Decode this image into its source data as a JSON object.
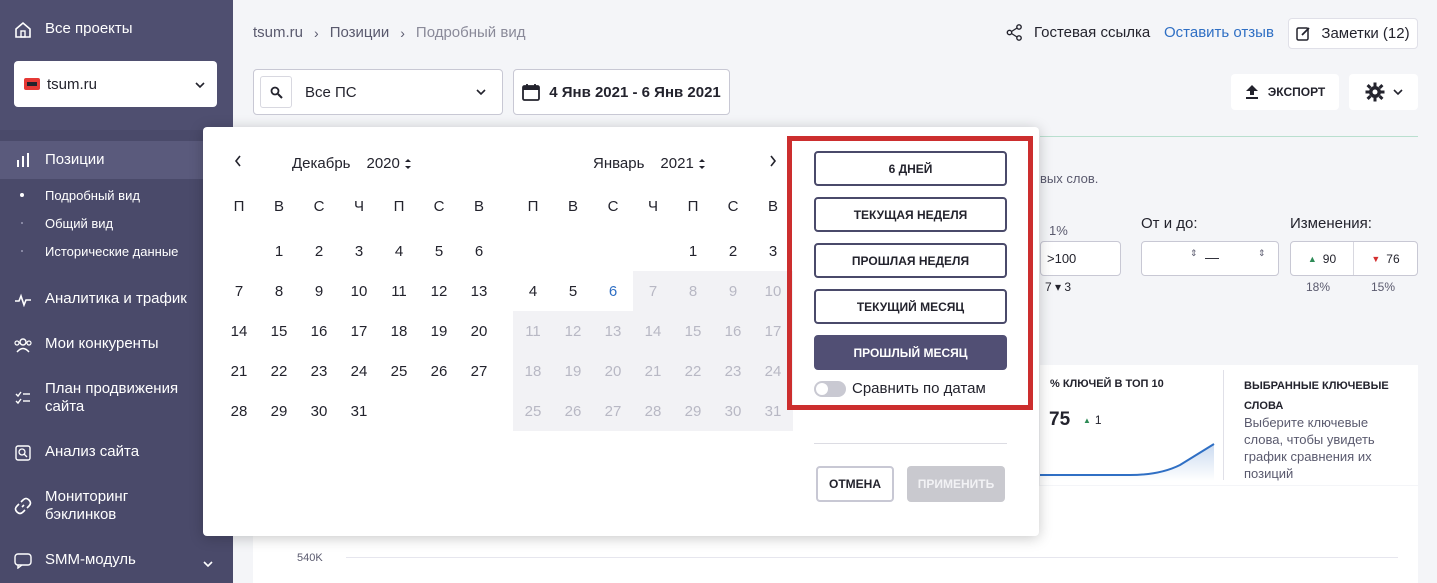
{
  "sidebar": {
    "all_projects": "Все проекты",
    "project": "tsum.ru",
    "items": [
      {
        "label": "Позиции"
      },
      {
        "label": "Аналитика и трафик"
      },
      {
        "label": "Мои конкуренты"
      },
      {
        "label": "План продвижения сайта"
      },
      {
        "label": "Анализ сайта"
      },
      {
        "label": "Мониторинг бэклинков"
      },
      {
        "label": "SMM-модуль"
      }
    ],
    "subitems": [
      {
        "label": "Подробный вид"
      },
      {
        "label": "Общий вид"
      },
      {
        "label": "Исторические данные"
      }
    ]
  },
  "header": {
    "breadcrumb": [
      "tsum.ru",
      "Позиции",
      "Подробный вид"
    ],
    "guest_link": "Гостевая ссылка",
    "feedback": "Оставить отзыв",
    "notes": "Заметки (12)",
    "search_engine": "Все ПС",
    "date_range": "4 Янв 2021 - 6 Янв 2021",
    "export": "ЭКСПОРТ"
  },
  "background": {
    "keywords_snippet": "вых слов.",
    "pct": "1%",
    "range_value": ">100",
    "range_stats": "7 ▾ 3",
    "from_to_label": "От и до:",
    "dash": "—",
    "changes_label": "Изменения:",
    "up_value": "90",
    "down_value": "76",
    "up_pct": "18%",
    "down_pct": "15%",
    "top10_label": "% КЛЮЧЕЙ В ТОП 10",
    "top10_value": "75",
    "top10_delta": "1",
    "selected_title": "ВЫБРАННЫЕ КЛЮЧЕВЫЕ СЛОВА",
    "selected_hint": "Выберите ключевые слова, чтобы увидеть график сравнения их позиций",
    "chart_tick": "540K"
  },
  "calendar": {
    "left": {
      "month": "Декабрь",
      "year": "2020",
      "weeks": [
        [
          "",
          "1",
          "2",
          "3",
          "4",
          "5",
          "6"
        ],
        [
          "7",
          "8",
          "9",
          "10",
          "11",
          "12",
          "13"
        ],
        [
          "14",
          "15",
          "16",
          "17",
          "18",
          "19",
          "20"
        ],
        [
          "21",
          "22",
          "23",
          "24",
          "25",
          "26",
          "27"
        ],
        [
          "28",
          "29",
          "30",
          "31",
          "",
          "",
          ""
        ]
      ]
    },
    "right": {
      "month": "Январь",
      "year": "2021",
      "weeks": [
        [
          "",
          "",
          "",
          "",
          "1",
          "2",
          "3"
        ],
        [
          "4",
          "5",
          "6",
          "7",
          "8",
          "9",
          "10"
        ],
        [
          "11",
          "12",
          "13",
          "14",
          "15",
          "16",
          "17"
        ],
        [
          "18",
          "19",
          "20",
          "21",
          "22",
          "23",
          "24"
        ],
        [
          "25",
          "26",
          "27",
          "28",
          "29",
          "30",
          "31"
        ]
      ],
      "today": "6"
    },
    "weekdays": [
      "П",
      "В",
      "С",
      "Ч",
      "П",
      "С",
      "В"
    ]
  },
  "presets": [
    "6 ДНЕЙ",
    "ТЕКУЩАЯ НЕДЕЛЯ",
    "ПРОШЛАЯ НЕДЕЛЯ",
    "ТЕКУЩИЙ МЕСЯЦ",
    "ПРОШЛЫЙ МЕСЯЦ"
  ],
  "active_preset": "ПРОШЛЫЙ МЕСЯЦ",
  "compare_label": "Сравнить по датам",
  "compare_enabled": false,
  "cancel": "ОТМЕНА",
  "apply": "ПРИМЕНИТЬ",
  "colors": {
    "sidebar": "#4a4a6a",
    "accent": "#2f6fc4",
    "highlight": "#cc2e2e",
    "active_preset": "#514f74"
  }
}
